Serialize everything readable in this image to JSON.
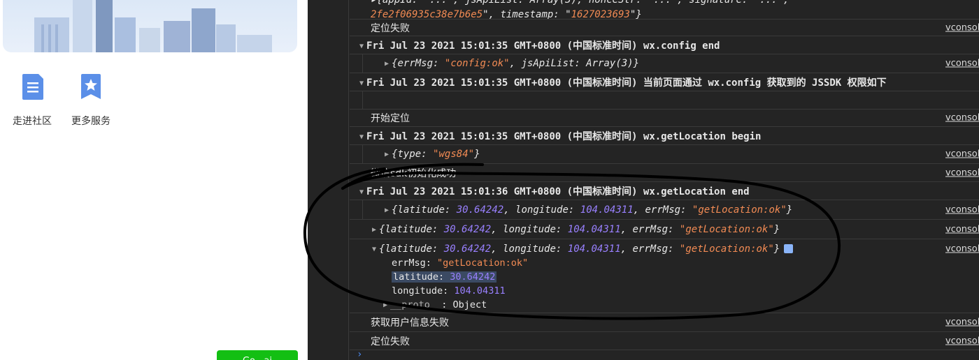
{
  "left_panel": {
    "services": [
      {
        "label": "走进社区",
        "icon": "document-icon"
      },
      {
        "label": "更多服务",
        "icon": "star-bookmark-icon"
      }
    ],
    "green_button_label": "Go   ai"
  },
  "console": {
    "source_label": "vconsole",
    "rows": [
      {
        "id": "r0",
        "parts": {
          "a": "{appId: \"...\", jsApiList: Array(3), nonceStr: \"...\", signature: \"...\",",
          "b": "2fe2f06935c38e7b6e5",
          "c": "\", timestamp: \"",
          "d": "1627023693",
          "e": "\"}"
        }
      },
      {
        "id": "r1",
        "text": "定位失败"
      },
      {
        "id": "r2",
        "text": "Fri Jul 23 2021 15:01:35 GMT+0800 (中国标准时间) wx.config end"
      },
      {
        "id": "r3",
        "parts": {
          "a": "{errMsg: ",
          "b": "\"config:ok\"",
          "c": ", jsApiList: Array(3)}"
        }
      },
      {
        "id": "r4",
        "text": "Fri Jul 23 2021 15:01:35 GMT+0800 (中国标准时间) 当前页面通过 wx.config 获取到的 JSSDK 权限如下"
      },
      {
        "id": "r5",
        "text": ""
      },
      {
        "id": "r6",
        "text": "开始定位"
      },
      {
        "id": "r7",
        "text": "Fri Jul 23 2021 15:01:35 GMT+0800 (中国标准时间) wx.getLocation begin"
      },
      {
        "id": "r8",
        "parts": {
          "a": "{type: ",
          "b": "\"wgs84\"",
          "c": "}"
        }
      },
      {
        "id": "r9",
        "text": "微信sdk初始化成功"
      },
      {
        "id": "r10",
        "text": "Fri Jul 23 2021 15:01:36 GMT+0800 (中国标准时间) wx.getLocation end"
      },
      {
        "id": "r11",
        "parts": {
          "a": "{latitude: ",
          "b": "30.64242",
          "c": ", longitude: ",
          "d": "104.04311",
          "e": ", errMsg: ",
          "f": "\"getLocation:ok\"",
          "g": "}"
        }
      },
      {
        "id": "r12",
        "parts": {
          "a": "{latitude: ",
          "b": "30.64242",
          "c": ", longitude: ",
          "d": "104.04311",
          "e": ", errMsg: ",
          "f": "\"getLocation:ok\"",
          "g": "}"
        }
      },
      {
        "id": "r13",
        "parts": {
          "a": "{latitude: ",
          "b": "30.64242",
          "c": ", longitude: ",
          "d": "104.04311",
          "e": ", errMsg: ",
          "f": "\"getLocation:ok\"",
          "g": "}"
        },
        "props": [
          {
            "key": "errMsg",
            "value": "\"getLocation:ok\""
          },
          {
            "key": "latitude",
            "value": "30.64242"
          },
          {
            "key": "longitude",
            "value": "104.04311"
          },
          {
            "key": "__proto__",
            "value": "Object"
          }
        ]
      },
      {
        "id": "r14",
        "text": "获取用户信息失败"
      },
      {
        "id": "r15",
        "text": "定位失败"
      }
    ],
    "prompt_glyph": "›"
  },
  "colors": {
    "console_bg": "#242424",
    "string": "#f28b54",
    "number": "#9980ff",
    "text": "#e8e8e8",
    "annotation": "#000000",
    "button_green": "#13bf13"
  }
}
